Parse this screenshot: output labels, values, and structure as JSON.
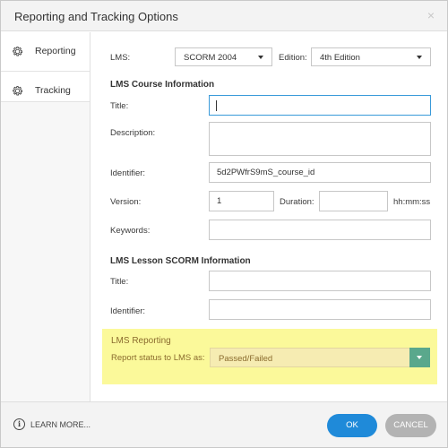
{
  "window": {
    "title": "Reporting and Tracking Options",
    "close_glyph": "×"
  },
  "sidebar": {
    "items": [
      {
        "label": "Reporting",
        "icon": "gear-icon",
        "active": true
      },
      {
        "label": "Tracking",
        "icon": "gear-icon",
        "active": false
      }
    ]
  },
  "lms": {
    "label": "LMS:",
    "value": "SCORM 2004"
  },
  "edition": {
    "label": "Edition:",
    "value": "4th Edition"
  },
  "course": {
    "section_title": "LMS Course Information",
    "title_label": "Title:",
    "title_value": "",
    "description_label": "Description:",
    "description_value": "",
    "identifier_label": "Identifier:",
    "identifier_value": "5d2PWfrS9mS_course_id",
    "version_label": "Version:",
    "version_value": "1",
    "duration_label": "Duration:",
    "duration_value": "",
    "duration_unit": "hh:mm:ss",
    "keywords_label": "Keywords:",
    "keywords_value": ""
  },
  "lesson": {
    "section_title": "LMS Lesson SCORM Information",
    "title_label": "Title:",
    "title_value": "",
    "identifier_label": "Identifier:",
    "identifier_value": ""
  },
  "reporting": {
    "section_title": "LMS Reporting",
    "status_label": "Report status to LMS as:",
    "status_value": "Passed/Failed",
    "highlight_color": "#fbf99a"
  },
  "footer": {
    "learn_more": "LEARN MORE...",
    "ok": "OK",
    "cancel": "CANCEL",
    "ok_color": "#1f8ad9",
    "cancel_color": "#b3b3b3"
  }
}
